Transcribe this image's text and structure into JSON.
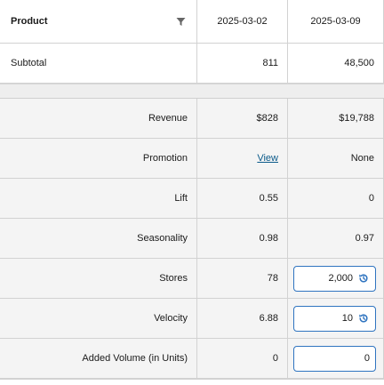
{
  "header": {
    "product_label": "Product",
    "filter_icon": "filter-icon",
    "columns": [
      "2025-03-02",
      "2025-03-09"
    ]
  },
  "subtotal": {
    "label": "Subtotal",
    "values": [
      "811",
      "48,500"
    ]
  },
  "metrics": {
    "revenue": {
      "label": "Revenue",
      "values": [
        "$828",
        "$19,788"
      ]
    },
    "promotion": {
      "label": "Promotion",
      "link": "View",
      "value2": "None"
    },
    "lift": {
      "label": "Lift",
      "values": [
        "0.55",
        "0"
      ]
    },
    "seasonality": {
      "label": "Seasonality",
      "values": [
        "0.98",
        "0.97"
      ]
    },
    "stores": {
      "label": "Stores",
      "value1": "78",
      "input_value": "2,000",
      "reset_icon": "reset-icon"
    },
    "velocity": {
      "label": "Velocity",
      "value1": "6.88",
      "input_value": "10",
      "reset_icon": "reset-icon"
    },
    "added_volume": {
      "label": "Added Volume (in Units)",
      "value1": "0",
      "input_value": "0"
    }
  },
  "colors": {
    "accent": "#2f74c0",
    "link": "#0b5a8a",
    "row_background": "#f4f4f4",
    "border": "#d2d2d2"
  }
}
